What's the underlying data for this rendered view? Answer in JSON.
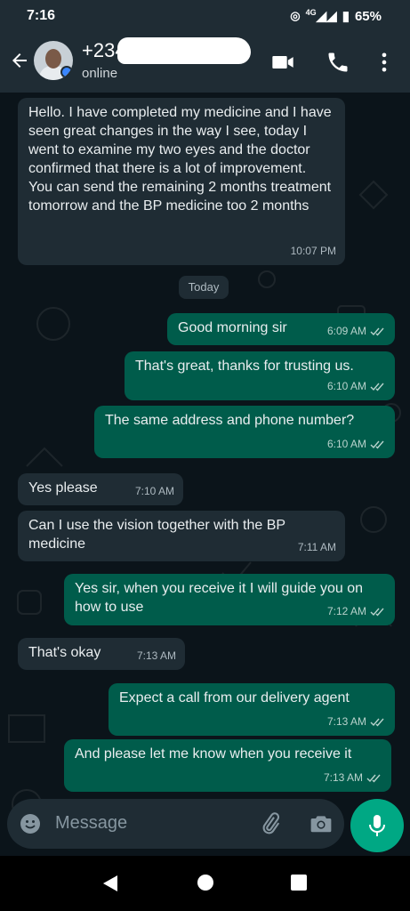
{
  "status_bar": {
    "time": "7:16",
    "network": "4G",
    "battery": "65%"
  },
  "header": {
    "contact_name": "+234",
    "contact_status": "online",
    "icons": [
      "back-arrow-icon",
      "video-call-icon",
      "phone-icon",
      "more-options-icon"
    ]
  },
  "day_divider": "Today",
  "messages": [
    {
      "dir": "in",
      "text": "Hello. I have completed my medicine and I have seen great changes in the way I see, today I went to examine my two eyes and the doctor confirmed that there is a lot of improvement.\nYou can send the remaining 2 months treatment tomorrow and the BP medicine too 2 months",
      "time": "10:07 PM"
    },
    {
      "dir": "out",
      "text": "Good morning sir",
      "time": "6:09 AM"
    },
    {
      "dir": "out",
      "text": "That's great, thanks for trusting us.",
      "time": "6:10 AM"
    },
    {
      "dir": "out",
      "text": "The same address and phone number?",
      "time": "6:10 AM"
    },
    {
      "dir": "in",
      "text": "Yes please",
      "time": "7:10 AM"
    },
    {
      "dir": "in",
      "text": "Can I use the vision together with the BP medicine",
      "time": "7:11 AM"
    },
    {
      "dir": "out",
      "text": "Yes sir, when you receive it I will guide you on how to use",
      "time": "7:12 AM"
    },
    {
      "dir": "in",
      "text": "That's okay",
      "time": "7:13 AM"
    },
    {
      "dir": "out",
      "text": "Expect a call from our delivery agent",
      "time": "7:13 AM"
    },
    {
      "dir": "out",
      "text": "And please let me know when you receive it",
      "time": "7:13 AM"
    }
  ],
  "composer": {
    "placeholder": "Message"
  },
  "colors": {
    "header": "#1f2c34",
    "incoming": "#1f2c34",
    "outgoing": "#005c4b",
    "accent": "#00a884",
    "background": "#0b141a"
  }
}
